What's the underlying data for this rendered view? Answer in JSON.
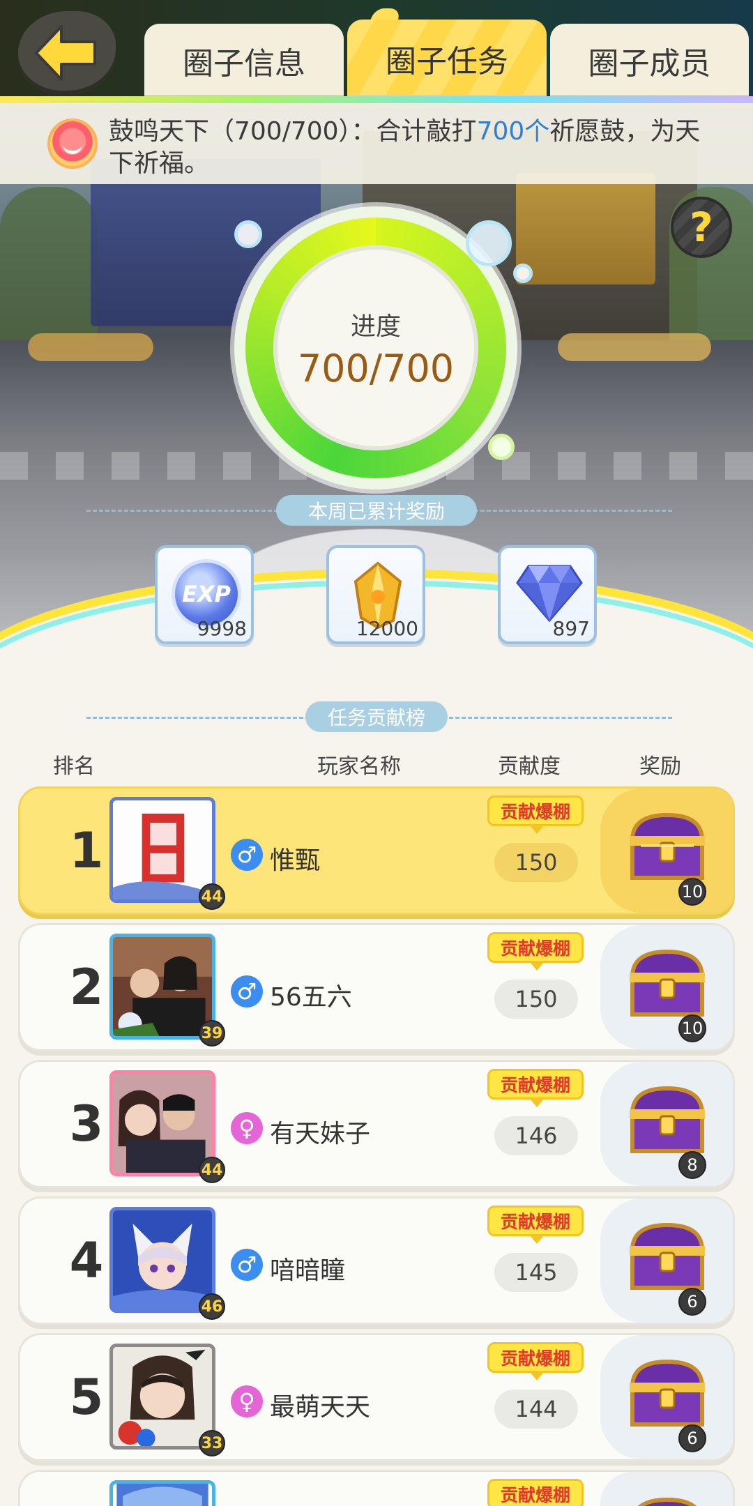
{
  "tabs": [
    {
      "label": "圈子信息",
      "active": false
    },
    {
      "label": "圈子任务",
      "active": true
    },
    {
      "label": "圈子成员",
      "active": false
    }
  ],
  "task": {
    "title_prefix": "鼓鸣天下（700/700）：合计敲打",
    "highlight": "700个",
    "title_suffix": "祈愿鼓，为天下祈福。"
  },
  "progress": {
    "label": "进度",
    "value_text": "700/700",
    "current": 700,
    "total": 700
  },
  "weekly_rewards": {
    "header": "本周已累计奖励",
    "items": [
      {
        "icon": "exp-icon",
        "count": "9998"
      },
      {
        "icon": "gold-crystal-icon",
        "count": "12000"
      },
      {
        "icon": "diamond-icon",
        "count": "897"
      }
    ]
  },
  "leaderboard": {
    "header": "任务贡献榜",
    "columns": {
      "rank": "排名",
      "name": "玩家名称",
      "contribution": "贡献度",
      "reward": "奖励"
    },
    "rows": [
      {
        "rank": "1",
        "name": "惟甄",
        "gender": "male",
        "level": "44",
        "tag": "贡献爆棚",
        "score": "150",
        "chest_count": "10"
      },
      {
        "rank": "2",
        "name": "56五六",
        "gender": "male",
        "level": "39",
        "tag": "贡献爆棚",
        "score": "150",
        "chest_count": "10"
      },
      {
        "rank": "3",
        "name": "有天妹子",
        "gender": "female",
        "level": "44",
        "tag": "贡献爆棚",
        "score": "146",
        "chest_count": "8"
      },
      {
        "rank": "4",
        "name": "喑暗瞳",
        "gender": "male",
        "level": "46",
        "tag": "贡献爆棚",
        "score": "145",
        "chest_count": "6"
      },
      {
        "rank": "5",
        "name": "最萌天天",
        "gender": "female",
        "level": "33",
        "tag": "贡献爆棚",
        "score": "144",
        "chest_count": "6"
      },
      {
        "rank": "",
        "name": "",
        "gender": "",
        "level": "",
        "tag": "贡献爆棚",
        "score": "",
        "chest_count": ""
      }
    ]
  },
  "colors": {
    "accent_yellow": "#ffe16a",
    "progress_green": "#4bd63a",
    "highlight_blue": "#2f7fd6",
    "male_blue": "#3c8df0",
    "female_pink": "#e466d6"
  }
}
